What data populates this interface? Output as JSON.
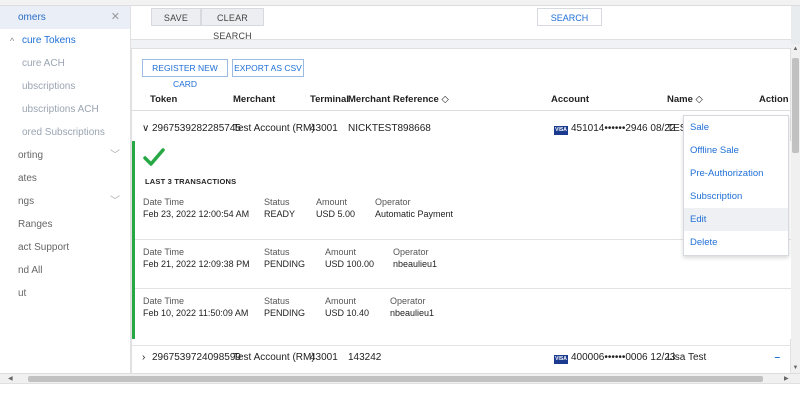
{
  "sidebar": {
    "customers": "omers",
    "items": [
      {
        "label": "cure Tokens"
      },
      {
        "label": "cure ACH"
      },
      {
        "label": "ubscriptions"
      },
      {
        "label": "ubscriptions ACH"
      },
      {
        "label": "ored Subscriptions"
      },
      {
        "label": "orting"
      },
      {
        "label": "ates"
      },
      {
        "label": "ngs"
      },
      {
        "label": "Ranges"
      },
      {
        "label": "act Support"
      },
      {
        "label": "nd All"
      },
      {
        "label": "ut"
      }
    ]
  },
  "toolbar": {
    "save_label": "SAVE",
    "clear_search_label": "CLEAR SEARCH",
    "search_label": "SEARCH"
  },
  "actions": {
    "register_new_card": "REGISTER NEW CARD",
    "export_csv": "EXPORT AS CSV"
  },
  "table": {
    "columns": {
      "token": "Token",
      "merchant": "Merchant",
      "terminal": "Terminal",
      "merchant_reference": "Merchant Reference",
      "account": "Account",
      "name": "Name",
      "action": "Action"
    },
    "rows": [
      {
        "token": "2967539282285745",
        "merchant": "Test Account (RM)",
        "terminal": "43001",
        "reference": "NICKTEST898668",
        "account": "451014••••••2946 08/22",
        "name": "TEST"
      },
      {
        "token": "2967539724098599",
        "merchant": "Test Account (RM)",
        "terminal": "43001",
        "reference": "143242",
        "account": "400006••••••0006 12/23",
        "name": "Lisa Test"
      }
    ]
  },
  "detail": {
    "heading": "LAST 3 TRANSACTIONS",
    "labels": {
      "datetime": "Date Time",
      "status": "Status",
      "amount": "Amount",
      "operator": "Operator"
    },
    "transactions": [
      {
        "datetime": "Feb 23, 2022 12:00:54 AM",
        "status": "READY",
        "amount": "USD 5.00",
        "operator": "Automatic Payment"
      },
      {
        "datetime": "Feb 21, 2022 12:09:38 PM",
        "status": "PENDING",
        "amount": "USD 100.00",
        "operator": "nbeaulieu1"
      },
      {
        "datetime": "Feb 10, 2022 11:50:09 AM",
        "status": "PENDING",
        "amount": "USD 10.40",
        "operator": "nbeaulieu1"
      }
    ]
  },
  "menu": {
    "items": [
      {
        "label": "Sale"
      },
      {
        "label": "Offline Sale"
      },
      {
        "label": "Pre-Authorization"
      },
      {
        "label": "Subscription"
      },
      {
        "label": "Edit"
      },
      {
        "label": "Delete"
      }
    ]
  },
  "card_brand": "VISA",
  "colors": {
    "accent": "#1f6fd6",
    "success": "#27a844"
  }
}
